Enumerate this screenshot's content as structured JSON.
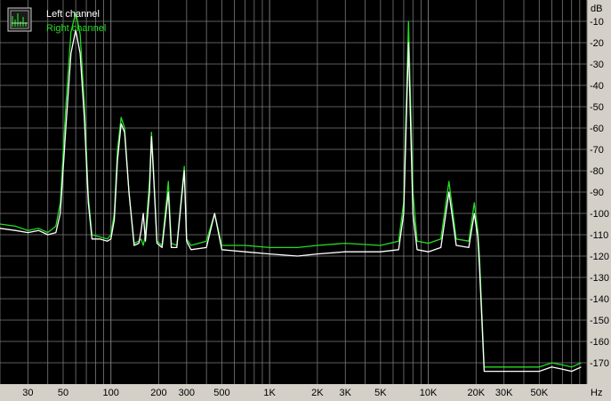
{
  "colors": {
    "plot_bg": "#000000",
    "grid": "#7a7a7a",
    "left_channel": "#ffffff",
    "right_channel": "#22dd22",
    "frame_bg": "#d4d0c8"
  },
  "legend": {
    "icon": "spectrum-icon",
    "items": [
      {
        "label": "Left channel",
        "color": "#ffffff"
      },
      {
        "label": "Right channel",
        "color": "#22dd22"
      }
    ]
  },
  "chart_data": {
    "type": "line",
    "title": "",
    "xlabel": "Hz",
    "ylabel": "dB",
    "x_scale": "log",
    "xlim": [
      20,
      100000
    ],
    "ylim": [
      -180,
      0
    ],
    "grid": true,
    "legend_position": "top-left",
    "x_ticks": [
      {
        "value": 30,
        "label": "30"
      },
      {
        "value": 50,
        "label": "50"
      },
      {
        "value": 100,
        "label": "100"
      },
      {
        "value": 200,
        "label": "200"
      },
      {
        "value": 300,
        "label": "300"
      },
      {
        "value": 500,
        "label": "500"
      },
      {
        "value": 1000,
        "label": "1K"
      },
      {
        "value": 2000,
        "label": "2K"
      },
      {
        "value": 3000,
        "label": "3K"
      },
      {
        "value": 5000,
        "label": "5K"
      },
      {
        "value": 10000,
        "label": "10K"
      },
      {
        "value": 20000,
        "label": "20K"
      },
      {
        "value": 30000,
        "label": "30K"
      },
      {
        "value": 50000,
        "label": "50K"
      }
    ],
    "y_ticks": [
      -10,
      -20,
      -30,
      -40,
      -50,
      -60,
      -70,
      -80,
      -90,
      -100,
      -110,
      -120,
      -130,
      -140,
      -150,
      -160,
      -170
    ],
    "series": [
      {
        "name": "Left channel",
        "color": "#ffffff",
        "points": [
          [
            20,
            -107
          ],
          [
            25,
            -108
          ],
          [
            30,
            -109
          ],
          [
            35,
            -108
          ],
          [
            40,
            -110
          ],
          [
            45,
            -109
          ],
          [
            48,
            -100
          ],
          [
            52,
            -60
          ],
          [
            56,
            -25
          ],
          [
            60,
            -14
          ],
          [
            64,
            -25
          ],
          [
            68,
            -55
          ],
          [
            72,
            -95
          ],
          [
            76,
            -112
          ],
          [
            85,
            -112
          ],
          [
            95,
            -113
          ],
          [
            100,
            -112
          ],
          [
            105,
            -103
          ],
          [
            110,
            -75
          ],
          [
            116,
            -58
          ],
          [
            122,
            -62
          ],
          [
            130,
            -90
          ],
          [
            140,
            -115
          ],
          [
            150,
            -114
          ],
          [
            155,
            -108
          ],
          [
            160,
            -100
          ],
          [
            165,
            -113
          ],
          [
            175,
            -90
          ],
          [
            180,
            -64
          ],
          [
            185,
            -80
          ],
          [
            195,
            -114
          ],
          [
            210,
            -116
          ],
          [
            230,
            -90
          ],
          [
            240,
            -116
          ],
          [
            260,
            -116
          ],
          [
            290,
            -80
          ],
          [
            300,
            -113
          ],
          [
            320,
            -117
          ],
          [
            400,
            -116
          ],
          [
            450,
            -100
          ],
          [
            500,
            -117
          ],
          [
            700,
            -118
          ],
          [
            1000,
            -119
          ],
          [
            1500,
            -120
          ],
          [
            2000,
            -119
          ],
          [
            3000,
            -118
          ],
          [
            5000,
            -118
          ],
          [
            6500,
            -117
          ],
          [
            7000,
            -100
          ],
          [
            7500,
            -20
          ],
          [
            8000,
            -100
          ],
          [
            8500,
            -117
          ],
          [
            10000,
            -118
          ],
          [
            12000,
            -116
          ],
          [
            13500,
            -90
          ],
          [
            15000,
            -115
          ],
          [
            18000,
            -116
          ],
          [
            19500,
            -100
          ],
          [
            20500,
            -111
          ],
          [
            21000,
            -125
          ],
          [
            22500,
            -174
          ],
          [
            30000,
            -174
          ],
          [
            40000,
            -174
          ],
          [
            50000,
            -174
          ],
          [
            60000,
            -172
          ],
          [
            70000,
            -173
          ],
          [
            80000,
            -174
          ],
          [
            92000,
            -172
          ]
        ]
      },
      {
        "name": "Right channel",
        "color": "#22dd22",
        "points": [
          [
            20,
            -105
          ],
          [
            25,
            -106
          ],
          [
            30,
            -108
          ],
          [
            35,
            -107
          ],
          [
            40,
            -109
          ],
          [
            45,
            -106
          ],
          [
            48,
            -95
          ],
          [
            52,
            -50
          ],
          [
            56,
            -15
          ],
          [
            60,
            -6
          ],
          [
            64,
            -16
          ],
          [
            68,
            -48
          ],
          [
            72,
            -92
          ],
          [
            76,
            -110
          ],
          [
            85,
            -111
          ],
          [
            95,
            -112
          ],
          [
            100,
            -110
          ],
          [
            105,
            -100
          ],
          [
            110,
            -70
          ],
          [
            116,
            -55
          ],
          [
            122,
            -60
          ],
          [
            130,
            -90
          ],
          [
            140,
            -114
          ],
          [
            150,
            -113
          ],
          [
            155,
            -112
          ],
          [
            160,
            -115
          ],
          [
            165,
            -110
          ],
          [
            175,
            -85
          ],
          [
            180,
            -62
          ],
          [
            185,
            -78
          ],
          [
            195,
            -113
          ],
          [
            210,
            -115
          ],
          [
            230,
            -85
          ],
          [
            240,
            -114
          ],
          [
            260,
            -115
          ],
          [
            290,
            -78
          ],
          [
            300,
            -112
          ],
          [
            320,
            -115
          ],
          [
            400,
            -113
          ],
          [
            450,
            -100
          ],
          [
            500,
            -115
          ],
          [
            700,
            -115
          ],
          [
            1000,
            -116
          ],
          [
            1500,
            -116
          ],
          [
            2000,
            -115
          ],
          [
            3000,
            -114
          ],
          [
            5000,
            -115
          ],
          [
            6500,
            -113
          ],
          [
            7000,
            -95
          ],
          [
            7500,
            -10
          ],
          [
            8000,
            -90
          ],
          [
            8500,
            -113
          ],
          [
            10000,
            -114
          ],
          [
            12000,
            -112
          ],
          [
            13500,
            -85
          ],
          [
            15000,
            -112
          ],
          [
            18000,
            -113
          ],
          [
            19500,
            -95
          ],
          [
            20500,
            -108
          ],
          [
            21000,
            -120
          ],
          [
            22500,
            -172
          ],
          [
            30000,
            -172
          ],
          [
            40000,
            -172
          ],
          [
            50000,
            -172
          ],
          [
            60000,
            -170
          ],
          [
            70000,
            -171
          ],
          [
            80000,
            -172
          ],
          [
            92000,
            -170
          ]
        ]
      }
    ]
  }
}
